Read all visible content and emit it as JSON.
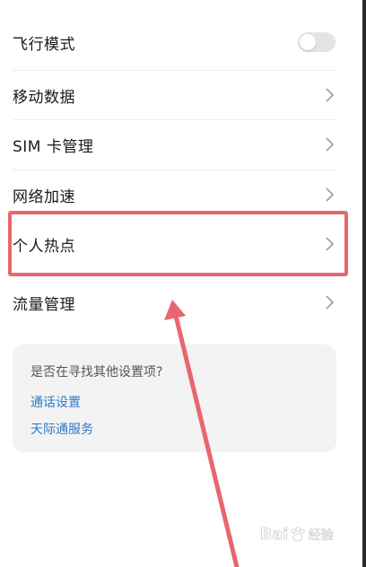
{
  "settings": {
    "airplane_mode": {
      "label": "飞行模式",
      "enabled": false
    },
    "mobile_data": {
      "label": "移动数据"
    },
    "sim_management": {
      "label": "SIM 卡管理"
    },
    "network_boost": {
      "label": "网络加速"
    },
    "personal_hotspot": {
      "label": "个人热点"
    },
    "data_usage": {
      "label": "流量管理"
    }
  },
  "suggestion_card": {
    "question": "是否在寻找其他设置项?",
    "links": [
      "通话设置",
      "天际通服务"
    ]
  },
  "annotation": {
    "highlight_target": "个人热点",
    "color": "#e8666f"
  },
  "watermark": {
    "brand": "Bai",
    "sub": "经验"
  },
  "colors": {
    "link": "#2a7ac9",
    "card_background": "#f3f3f3"
  }
}
